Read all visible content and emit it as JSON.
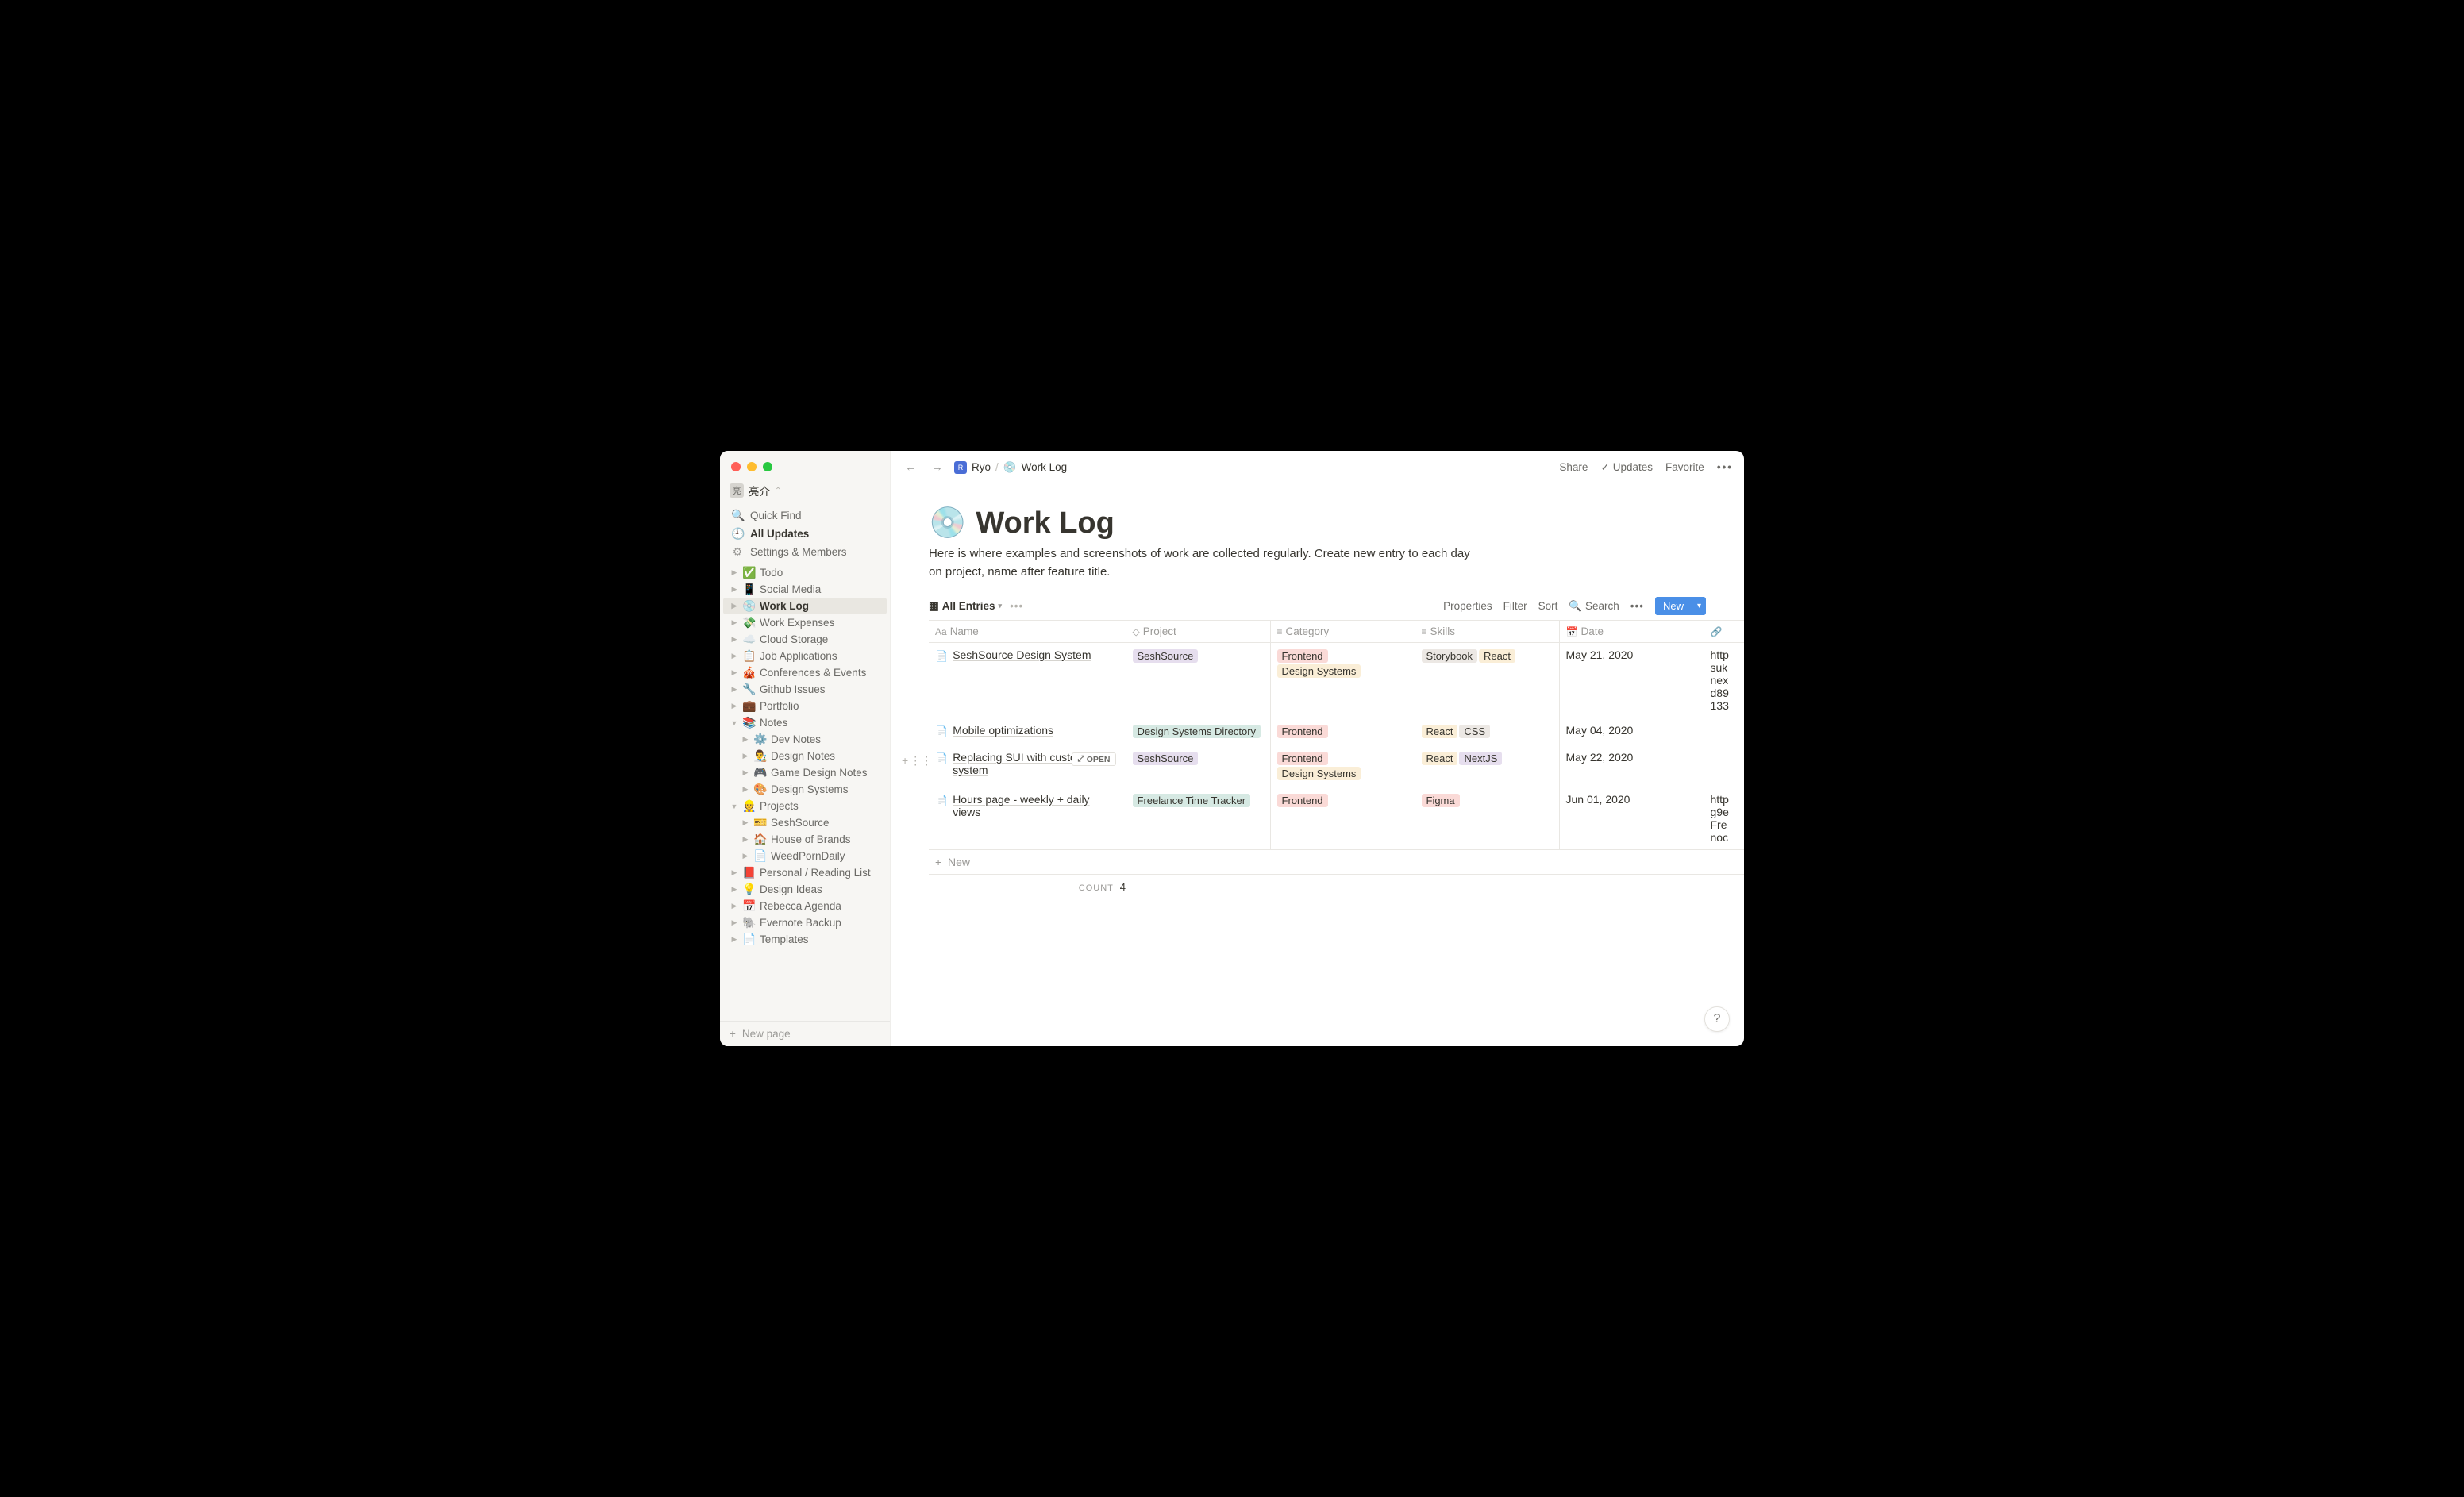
{
  "workspace": {
    "name": "亮介",
    "chevron": "⌃"
  },
  "sidebar_nav": {
    "quick_find": "Quick Find",
    "all_updates": "All Updates",
    "settings": "Settings & Members"
  },
  "tree": [
    {
      "depth": 0,
      "emoji": "✅",
      "label": "Todo",
      "caret": "▶"
    },
    {
      "depth": 0,
      "emoji": "📱",
      "label": "Social Media",
      "caret": "▶"
    },
    {
      "depth": 0,
      "emoji": "💿",
      "label": "Work Log",
      "caret": "▶",
      "active": true
    },
    {
      "depth": 0,
      "emoji": "💸",
      "label": "Work Expenses",
      "caret": "▶"
    },
    {
      "depth": 0,
      "emoji": "☁️",
      "label": "Cloud Storage",
      "caret": "▶"
    },
    {
      "depth": 0,
      "emoji": "📋",
      "label": "Job Applications",
      "caret": "▶"
    },
    {
      "depth": 0,
      "emoji": "🎪",
      "label": "Conferences & Events",
      "caret": "▶"
    },
    {
      "depth": 0,
      "emoji": "🔧",
      "label": "Github Issues",
      "caret": "▶"
    },
    {
      "depth": 0,
      "emoji": "💼",
      "label": "Portfolio",
      "caret": "▶"
    },
    {
      "depth": 0,
      "emoji": "📚",
      "label": "Notes",
      "caret": "▼"
    },
    {
      "depth": 1,
      "emoji": "⚙️",
      "label": "Dev Notes",
      "caret": "▶"
    },
    {
      "depth": 1,
      "emoji": "👨‍🎨",
      "label": "Design Notes",
      "caret": "▶"
    },
    {
      "depth": 1,
      "emoji": "🎮",
      "label": "Game Design Notes",
      "caret": "▶"
    },
    {
      "depth": 1,
      "emoji": "🎨",
      "label": "Design Systems",
      "caret": "▶"
    },
    {
      "depth": 0,
      "emoji": "👷",
      "label": "Projects",
      "caret": "▼"
    },
    {
      "depth": 1,
      "emoji": "🎫",
      "label": "SeshSource",
      "caret": "▶"
    },
    {
      "depth": 1,
      "emoji": "🏠",
      "label": "House of Brands",
      "caret": "▶"
    },
    {
      "depth": 1,
      "emoji": "📄",
      "label": "WeedPornDaily",
      "caret": "▶"
    },
    {
      "depth": 0,
      "emoji": "📕",
      "label": "Personal / Reading List",
      "caret": "▶"
    },
    {
      "depth": 0,
      "emoji": "💡",
      "label": "Design Ideas",
      "caret": "▶"
    },
    {
      "depth": 0,
      "emoji": "📅",
      "label": "Rebecca Agenda",
      "caret": "▶"
    },
    {
      "depth": 0,
      "emoji": "🐘",
      "label": "Evernote Backup",
      "caret": "▶"
    },
    {
      "depth": 0,
      "emoji": "📄",
      "label": "Templates",
      "caret": "▶"
    }
  ],
  "sidebar_footer": {
    "new_page": "New page"
  },
  "topbar": {
    "breadcrumb": {
      "root": "Ryo",
      "sep": "/",
      "page_emoji": "💿",
      "page": "Work Log"
    },
    "share": "Share",
    "updates": "Updates",
    "favorite": "Favorite"
  },
  "page": {
    "emoji": "💿",
    "title": "Work Log",
    "description": "Here is where examples and screenshots of work are collected regularly. Create new entry to each day on project, name after feature title."
  },
  "db_toolbar": {
    "view_icon": "▦",
    "view_name": "All Entries",
    "properties": "Properties",
    "filter": "Filter",
    "sort": "Sort",
    "search": "Search",
    "new": "New"
  },
  "columns": {
    "name": "Name",
    "project": "Project",
    "category": "Category",
    "skills": "Skills",
    "date": "Date",
    "link": ""
  },
  "tag_colors": {
    "SeshSource": "#e6deee",
    "Design Systems Directory": "#d6e9e3",
    "Freelance Time Tracker": "#d6e9e3",
    "Frontend": "#fadad7",
    "Design Systems": "#faeed7",
    "Storybook": "#ece8e4",
    "React": "#faeed7",
    "CSS": "#ece8e4",
    "NextJS": "#e6deee",
    "Figma": "#fadad7"
  },
  "rows": [
    {
      "name": "SeshSource Design System",
      "project": [
        "SeshSource"
      ],
      "category": [
        "Frontend",
        "Design Systems"
      ],
      "skills": [
        "Storybook",
        "React"
      ],
      "date": "May 21, 2020",
      "link": "http suk nex d89 133"
    },
    {
      "name": "Mobile optimizations",
      "project": [
        "Design Systems Directory"
      ],
      "category": [
        "Frontend"
      ],
      "skills": [
        "React",
        "CSS"
      ],
      "date": "May 04, 2020",
      "link": ""
    },
    {
      "name": "Replacing SUI with custom system",
      "project": [
        "SeshSource"
      ],
      "category": [
        "Frontend",
        "Design Systems"
      ],
      "skills": [
        "React",
        "NextJS"
      ],
      "date": "May 22, 2020",
      "link": "",
      "hovered": true,
      "open_label": "OPEN"
    },
    {
      "name": "Hours page - weekly + daily views",
      "project": [
        "Freelance Time Tracker"
      ],
      "category": [
        "Frontend"
      ],
      "skills": [
        "Figma"
      ],
      "date": "Jun 01, 2020",
      "link": "http g9e Fre noc"
    }
  ],
  "new_row_label": "New",
  "count": {
    "label": "COUNT",
    "value": "4"
  }
}
